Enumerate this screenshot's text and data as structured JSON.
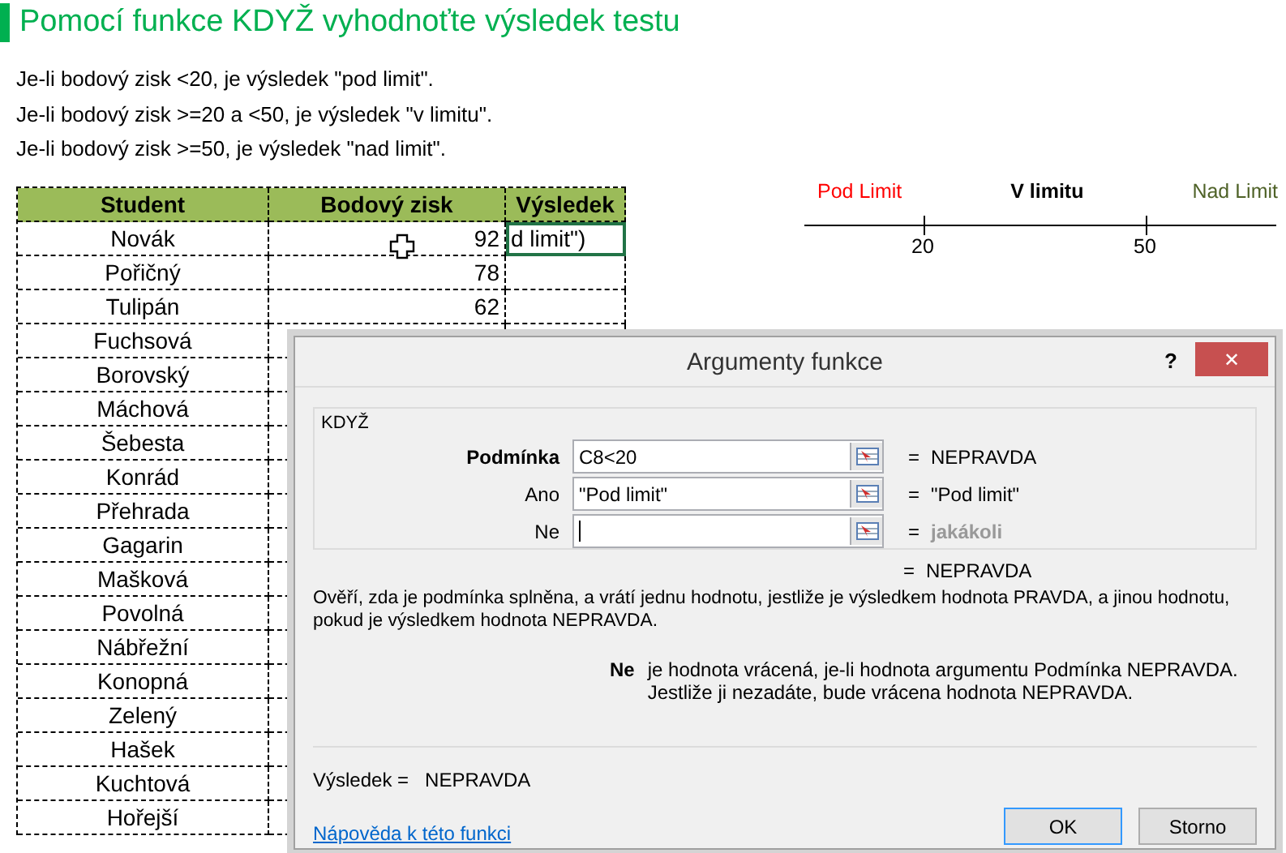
{
  "heading": "Pomocí funkce KDYŽ vyhodnoťte výsledek testu",
  "rules": [
    "Je-li bodový zisk <20, je výsledek \"pod limit\".",
    "Je-li bodový zisk >=20 a <50, je výsledek \"v limitu\".",
    "Je-li bodový zisk >=50, je výsledek \"nad limit\"."
  ],
  "table": {
    "columns": [
      "Student",
      "Bodový zisk",
      "Výsledek"
    ],
    "rows": [
      {
        "student": "Novák",
        "score": "92",
        "result": "d limit\")",
        "selected": true
      },
      {
        "student": "Pořičný",
        "score": "78",
        "selected": false
      },
      {
        "student": "Tulipán",
        "score": "62",
        "selected": false
      },
      {
        "student": "Fuchsová"
      },
      {
        "student": "Borovský"
      },
      {
        "student": "Máchová"
      },
      {
        "student": "Šebesta"
      },
      {
        "student": "Konrád"
      },
      {
        "student": "Přehrada"
      },
      {
        "student": "Gagarin"
      },
      {
        "student": "Mašková"
      },
      {
        "student": "Povolná"
      },
      {
        "student": "Nábřežní"
      },
      {
        "student": "Konopná"
      },
      {
        "student": "Zelený"
      },
      {
        "student": "Hašek"
      },
      {
        "student": "Kuchtová"
      },
      {
        "student": "Hořejší"
      }
    ]
  },
  "number_line": {
    "zones": [
      {
        "label": "Pod Limit",
        "color": "#ff0000",
        "bold": false
      },
      {
        "label": "V limitu",
        "color": "#000000",
        "bold": true
      },
      {
        "label": "Nad Limit",
        "color": "#4f6228",
        "bold": false
      }
    ],
    "ticks": [
      "20",
      "50"
    ]
  },
  "dialog": {
    "title": "Argumenty funkce",
    "help": "?",
    "close": "✕",
    "function": "KDYŽ",
    "arguments": [
      {
        "label": "Podmínka",
        "value": "C8<20",
        "equals": "=",
        "result": "NEPRAVDA",
        "required": true,
        "focused": false,
        "muted": false
      },
      {
        "label": "Ano",
        "value": "\"Pod limit\"",
        "equals": "=",
        "result": "\"Pod limit\"",
        "required": false,
        "focused": false,
        "muted": false
      },
      {
        "label": "Ne",
        "equals": "=",
        "result": "jakákoli",
        "required": false,
        "focused": true,
        "muted": true
      }
    ],
    "formula_equals": "=",
    "formula_result": "NEPRAVDA",
    "description": "Ověří, zda je podmínka splněna, a vrátí jednu hodnotu, jestliže je výsledkem hodnota PRAVDA, a jinou hodnotu, pokud je výsledkem hodnota NEPRAVDA.",
    "argument_help": {
      "name": "Ne",
      "lines": [
        "je hodnota vrácená, je-li hodnota argumentu Podmínka NEPRAVDA.",
        "Jestliže ji nezadáte, bude vrácena hodnota NEPRAVDA."
      ]
    },
    "result_label": "Výsledek =",
    "result_value": "NEPRAVDA",
    "link": "Nápověda k této funkci",
    "buttons": [
      {
        "label": "OK",
        "selected": true
      },
      {
        "label": "Storno",
        "selected": false
      }
    ]
  }
}
